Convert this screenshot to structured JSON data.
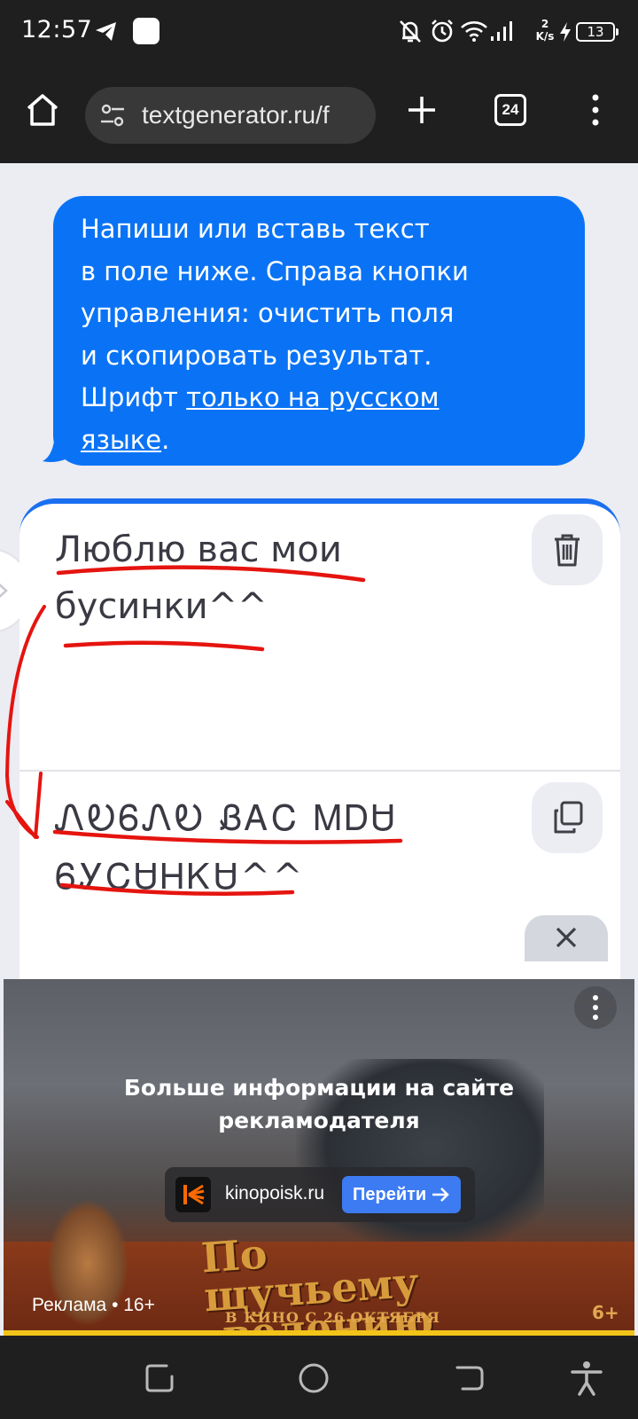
{
  "status_bar": {
    "time": "12:57",
    "net_speed_value": "2",
    "net_speed_unit": "K/s",
    "battery": "13",
    "icons": [
      "telegram-icon",
      "app-square-icon",
      "notifications-off-icon",
      "alarm-icon",
      "wifi-icon",
      "signal-icon",
      "charging-icon",
      "battery-icon"
    ]
  },
  "browser": {
    "url": "textgenerator.ru/f",
    "tab_count": "24"
  },
  "hint_bubble": {
    "line1": "Напиши или вставь текст",
    "line2": "в поле ниже. Справа кнопки",
    "line3": "управления: очистить поля",
    "line4": "и скопировать результат.",
    "line5_prefix": "Шрифт ",
    "link_part1": "только на русском",
    "link_part2": "языке",
    "suffix": "."
  },
  "generator": {
    "input_line1": "Люблю вас мои",
    "input_line2": "бусинки^^",
    "output_line1": "ᏁᎧᏮᏁᎧ ᏰᎪᏟ ᎷᎠᏌ",
    "output_line2": "ᏮᎩᏟᏌᎻᏦᏌ^^"
  },
  "ad": {
    "headline_line1": "Больше информации на сайте",
    "headline_line2": "рекламодателя",
    "domain": "kinopoisk.ru",
    "cta": "Перейти",
    "movie_title_line1": "По щучьему",
    "movie_title_line2": "велению",
    "movie_subtitle": "В КИНО С 26 ОКТЯБРЯ",
    "movie_age": "6+",
    "label": "Реклама • 16+"
  },
  "colors": {
    "accent": "#0a73f5",
    "card_border": "#1a6ff0",
    "annotation_red": "#e5140f",
    "bars": "#1f1f1f",
    "page_bg": "#ececf3"
  }
}
